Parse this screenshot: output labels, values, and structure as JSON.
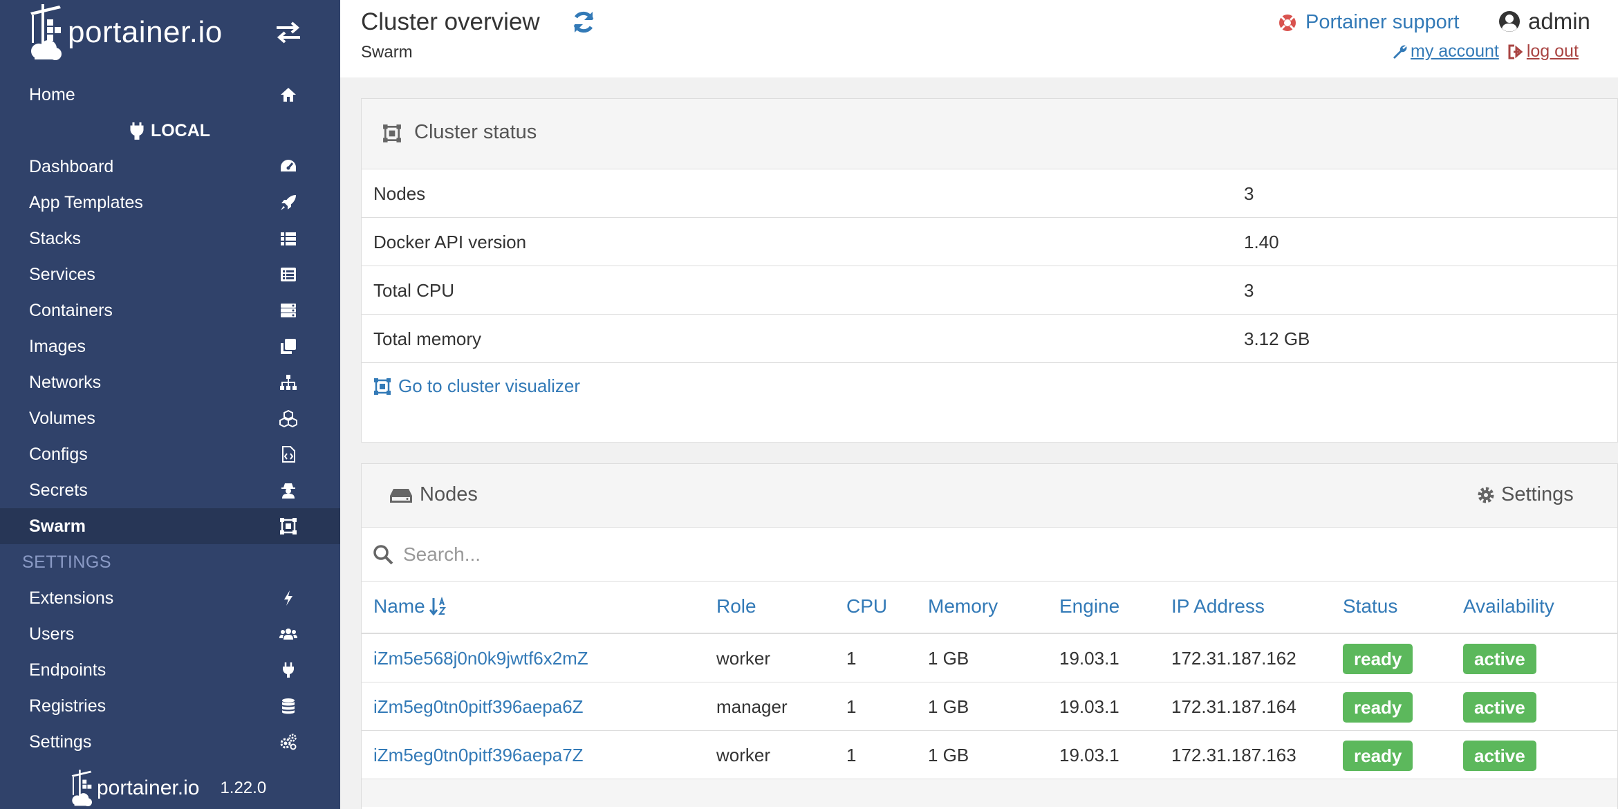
{
  "brand": {
    "logo_text": "portainer.io",
    "version": "1.22.0"
  },
  "sidebar": {
    "home_label": "Home",
    "endpoint_label": "LOCAL",
    "items": [
      {
        "label": "Dashboard",
        "icon": "dashboard-icon"
      },
      {
        "label": "App Templates",
        "icon": "rocket-icon"
      },
      {
        "label": "Stacks",
        "icon": "list-icon"
      },
      {
        "label": "Services",
        "icon": "list-alt-icon"
      },
      {
        "label": "Containers",
        "icon": "server-icon"
      },
      {
        "label": "Images",
        "icon": "clone-icon"
      },
      {
        "label": "Networks",
        "icon": "sitemap-icon"
      },
      {
        "label": "Volumes",
        "icon": "cubes-icon"
      },
      {
        "label": "Configs",
        "icon": "file-code-icon"
      },
      {
        "label": "Secrets",
        "icon": "user-secret-icon"
      },
      {
        "label": "Swarm",
        "icon": "object-group-icon",
        "active": true
      }
    ],
    "settings_header": "SETTINGS",
    "settings_items": [
      {
        "label": "Extensions",
        "icon": "bolt-icon"
      },
      {
        "label": "Users",
        "icon": "users-icon"
      },
      {
        "label": "Endpoints",
        "icon": "plug-icon"
      },
      {
        "label": "Registries",
        "icon": "database-icon"
      },
      {
        "label": "Settings",
        "icon": "cogs-icon"
      }
    ]
  },
  "header": {
    "title": "Cluster overview",
    "subtitle": "Swarm",
    "support_label": "Portainer support",
    "username": "admin",
    "my_account_label": "my account",
    "logout_label": "log out"
  },
  "cluster_status": {
    "title": "Cluster status",
    "rows": [
      {
        "key": "Nodes",
        "value": "3"
      },
      {
        "key": "Docker API version",
        "value": "1.40"
      },
      {
        "key": "Total CPU",
        "value": "3"
      },
      {
        "key": "Total memory",
        "value": "3.12 GB"
      }
    ],
    "visualizer_link": "Go to cluster visualizer"
  },
  "nodes": {
    "title": "Nodes",
    "settings_label": "Settings",
    "search_placeholder": "Search...",
    "columns": [
      "Name",
      "Role",
      "CPU",
      "Memory",
      "Engine",
      "IP Address",
      "Status",
      "Availability"
    ],
    "rows": [
      {
        "name": "iZm5e568j0n0k9jwtf6x2mZ",
        "role": "worker",
        "cpu": "1",
        "memory": "1 GB",
        "engine": "19.03.1",
        "ip": "172.31.187.162",
        "status": "ready",
        "availability": "active"
      },
      {
        "name": "iZm5eg0tn0pitf396aepa6Z",
        "role": "manager",
        "cpu": "1",
        "memory": "1 GB",
        "engine": "19.03.1",
        "ip": "172.31.187.164",
        "status": "ready",
        "availability": "active"
      },
      {
        "name": "iZm5eg0tn0pitf396aepa7Z",
        "role": "worker",
        "cpu": "1",
        "memory": "1 GB",
        "engine": "19.03.1",
        "ip": "172.31.187.163",
        "status": "ready",
        "availability": "active"
      }
    ]
  },
  "colors": {
    "sidebar_bg": "#30426a",
    "sidebar_active": "#273656",
    "link": "#337ab7",
    "badge_success": "#5cb85c",
    "logout": "#a94442"
  }
}
